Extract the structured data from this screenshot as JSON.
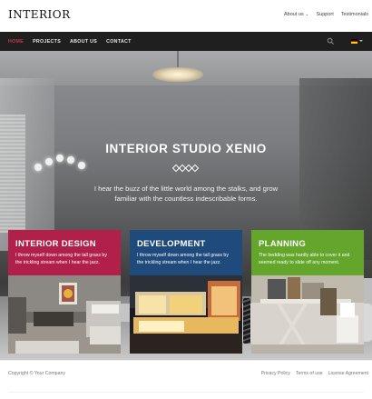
{
  "header": {
    "logo": "INTERIOR",
    "top_links": [
      "About us",
      "Support",
      "Testimonials"
    ]
  },
  "nav": {
    "items": [
      "HOME",
      "PROJECTS",
      "ABOUT US",
      "CONTACT"
    ],
    "active_index": 0,
    "language_icon": "german-flag-icon"
  },
  "hero": {
    "title": "INTERIOR STUDIO XENIO",
    "text": "I hear the buzz of the little world among the stalks, and grow familiar with the countless indescribable forms.",
    "slider_dots": 2,
    "active_dot": 0
  },
  "cards": [
    {
      "title": "INTERIOR DESIGN",
      "text": "I throw myself down among the tall grass by the trickling stream when I hear the jazz.",
      "color": "#b0204a"
    },
    {
      "title": "DEVELOPMENT",
      "text": "I throw myself down among the tall grass by the trickling stream when I hear the jazz.",
      "color": "#1f4a7c"
    },
    {
      "title": "PLANNING",
      "text": "The bedding was hardly able to cover it and seemed ready to slide off any moment.",
      "color": "#63a62b"
    }
  ],
  "footer": {
    "copyright": "Copyright © Your Company",
    "links": [
      "Privacy Policy",
      "Terms of use",
      "License Agreement"
    ]
  },
  "colors": {
    "accent": "#c23552",
    "nav_bg": "#1f1f1f"
  }
}
